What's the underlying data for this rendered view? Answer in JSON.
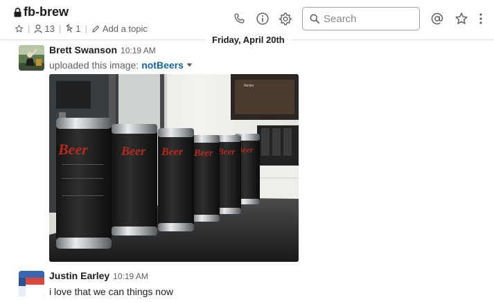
{
  "channel": {
    "name": "fb-brew",
    "members": "13",
    "pins": "1",
    "topic_placeholder": "Add a topic"
  },
  "header": {
    "search_placeholder": "Search"
  },
  "date_divider": "Friday, April 20th",
  "messages": [
    {
      "author": "Brett Swanson",
      "time": "10:19 AM",
      "action": "uploaded this image:",
      "file_name": "notBeers",
      "image_text": {
        "can_label": "Beer",
        "sign": "Nexter"
      }
    },
    {
      "author": "Justin Earley",
      "time": "10:19 AM",
      "text": "i love that we can things now"
    }
  ],
  "colors": {
    "link": "#1264a3",
    "can_label_red": "#b22a1f"
  }
}
